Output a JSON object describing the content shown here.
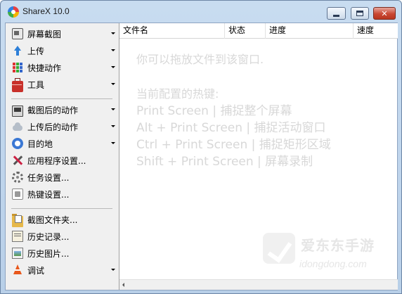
{
  "window": {
    "title": "ShareX 10.0",
    "controls": {
      "minimize": "minimize",
      "maximize": "maximize",
      "close": "✕"
    }
  },
  "sidebar": {
    "items": [
      {
        "label": "屏幕截图",
        "icon": "screenshot-icon",
        "has_dropdown": true
      },
      {
        "label": "上传",
        "icon": "upload-arrow-icon",
        "has_dropdown": true
      },
      {
        "label": "快捷动作",
        "icon": "quick-actions-grid-icon",
        "has_dropdown": true
      },
      {
        "label": "工具",
        "icon": "toolbox-icon",
        "has_dropdown": true
      },
      {
        "label": "截图后的动作",
        "icon": "after-capture-icon",
        "has_dropdown": true
      },
      {
        "label": "上传后的动作",
        "icon": "after-upload-cloud-icon",
        "has_dropdown": true
      },
      {
        "label": "目的地",
        "icon": "destination-icon",
        "has_dropdown": true
      },
      {
        "label": "应用程序设置...",
        "icon": "wrench-icon",
        "has_dropdown": false
      },
      {
        "label": "任务设置...",
        "icon": "gear-icon",
        "has_dropdown": false
      },
      {
        "label": "热键设置...",
        "icon": "keyboard-key-icon",
        "has_dropdown": false
      },
      {
        "label": "截图文件夹...",
        "icon": "folder-icon",
        "has_dropdown": false
      },
      {
        "label": "历史记录...",
        "icon": "history-icon",
        "has_dropdown": false
      },
      {
        "label": "历史图片...",
        "icon": "image-history-icon",
        "has_dropdown": false
      },
      {
        "label": "调试",
        "icon": "traffic-cone-icon",
        "has_dropdown": true
      }
    ]
  },
  "list": {
    "columns": [
      "文件名",
      "状态",
      "进度",
      "速度"
    ]
  },
  "hints": {
    "drop": "你可以拖放文件到该窗口.",
    "current_hotkeys": "当前配置的热键:",
    "hotkeys": [
      "Print Screen  |  捕捉整个屏幕",
      "Alt + Print Screen  |  捕捉活动窗口",
      "Ctrl + Print Screen  |  捕捉矩形区域",
      "Shift + Print Screen  |  屏幕录制"
    ]
  },
  "watermark": {
    "text": "爱东东手游",
    "url": "idongdong.com"
  }
}
